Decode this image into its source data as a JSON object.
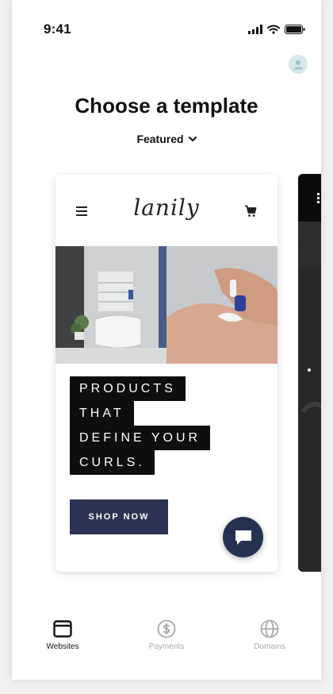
{
  "status_bar": {
    "time": "9:41"
  },
  "header": {
    "title": "Choose a template"
  },
  "filter": {
    "label": "Featured"
  },
  "template_card": {
    "brand": "lanily",
    "headline_lines": [
      "PRODUCTS",
      "THAT",
      "DEFINE YOUR",
      "CURLS."
    ],
    "cta_label": "SHOP NOW"
  },
  "tabbar": {
    "items": [
      {
        "label": "Websites",
        "icon": "browser-window-icon",
        "active": true
      },
      {
        "label": "Payments",
        "icon": "dollar-circle-icon",
        "active": false
      },
      {
        "label": "Domains",
        "icon": "globe-icon",
        "active": false
      }
    ]
  },
  "colors": {
    "cta": "#2b3252",
    "chat_fab": "#25324f",
    "avatar_bg": "#d7e8ec",
    "headline_bg": "#0e0e0e"
  }
}
